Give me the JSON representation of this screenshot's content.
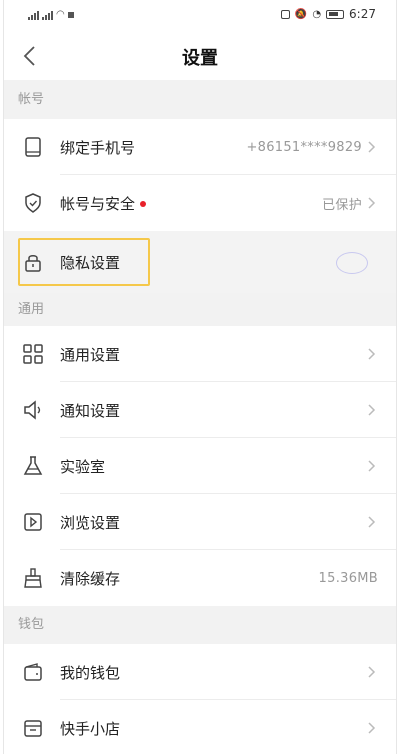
{
  "status_bar": {
    "time": "6:27"
  },
  "header": {
    "title": "设置"
  },
  "sections": {
    "account": "帐号",
    "general": "通用",
    "wallet": "钱包"
  },
  "rows": {
    "phone": {
      "label": "绑定手机号",
      "value": "+86151****9829"
    },
    "security": {
      "label": "帐号与安全",
      "value": "已保护"
    },
    "privacy": {
      "label": "隐私设置"
    },
    "general_settings": {
      "label": "通用设置"
    },
    "notifications": {
      "label": "通知设置"
    },
    "lab": {
      "label": "实验室"
    },
    "browse": {
      "label": "浏览设置"
    },
    "cache": {
      "label": "清除缓存",
      "value": "15.36MB"
    },
    "my_wallet": {
      "label": "我的钱包"
    },
    "shop": {
      "label": "快手小店"
    }
  },
  "icons": [
    "phone-icon",
    "shield-icon",
    "lock-icon",
    "grid-icon",
    "speaker-icon",
    "flask-icon",
    "play-box-icon",
    "broom-icon",
    "wallet-icon",
    "store-icon",
    "chevron-right-icon",
    "back-arrow-icon"
  ],
  "colors": {
    "highlight": "#f5c84a",
    "red_dot": "#e8202a"
  }
}
